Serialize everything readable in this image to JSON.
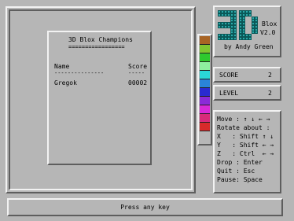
{
  "champions": {
    "title": "3D Blox Champions",
    "title_underline": "=================",
    "col_name": "Name",
    "col_score": "Score",
    "name_underline": "---------------",
    "score_underline": "-----",
    "entries": [
      {
        "name": "Gregok",
        "score": "00002"
      }
    ]
  },
  "logo": {
    "big_text": "3D",
    "line1": "Blox",
    "line2": "V2.0",
    "line3": "by Andy Green"
  },
  "score": {
    "label": "SCORE",
    "value": "2"
  },
  "level": {
    "label": "LEVEL",
    "value": "2"
  },
  "controls": {
    "lines": [
      "Move : ↑ ↓ ← →",
      "Rotate about :",
      "X   : Shift ↑ ↓",
      "Y   : Shift ← →",
      "Z   : Ctrl  ← →",
      "Drop : Enter",
      "Quit : Esc",
      "Pause: Space"
    ]
  },
  "status": {
    "message": "Press any key"
  },
  "colors": {
    "background": "#b6b6b6",
    "logo_cube": "#2aa8a8",
    "palette": [
      "#a86424",
      "#7ec630",
      "#2ec92e",
      "#8ef0a0",
      "#2ad8d8",
      "#2a84d8",
      "#2a2ad0",
      "#8a2ad8",
      "#d82ad8",
      "#d82a7a",
      "#d82a2a"
    ]
  }
}
